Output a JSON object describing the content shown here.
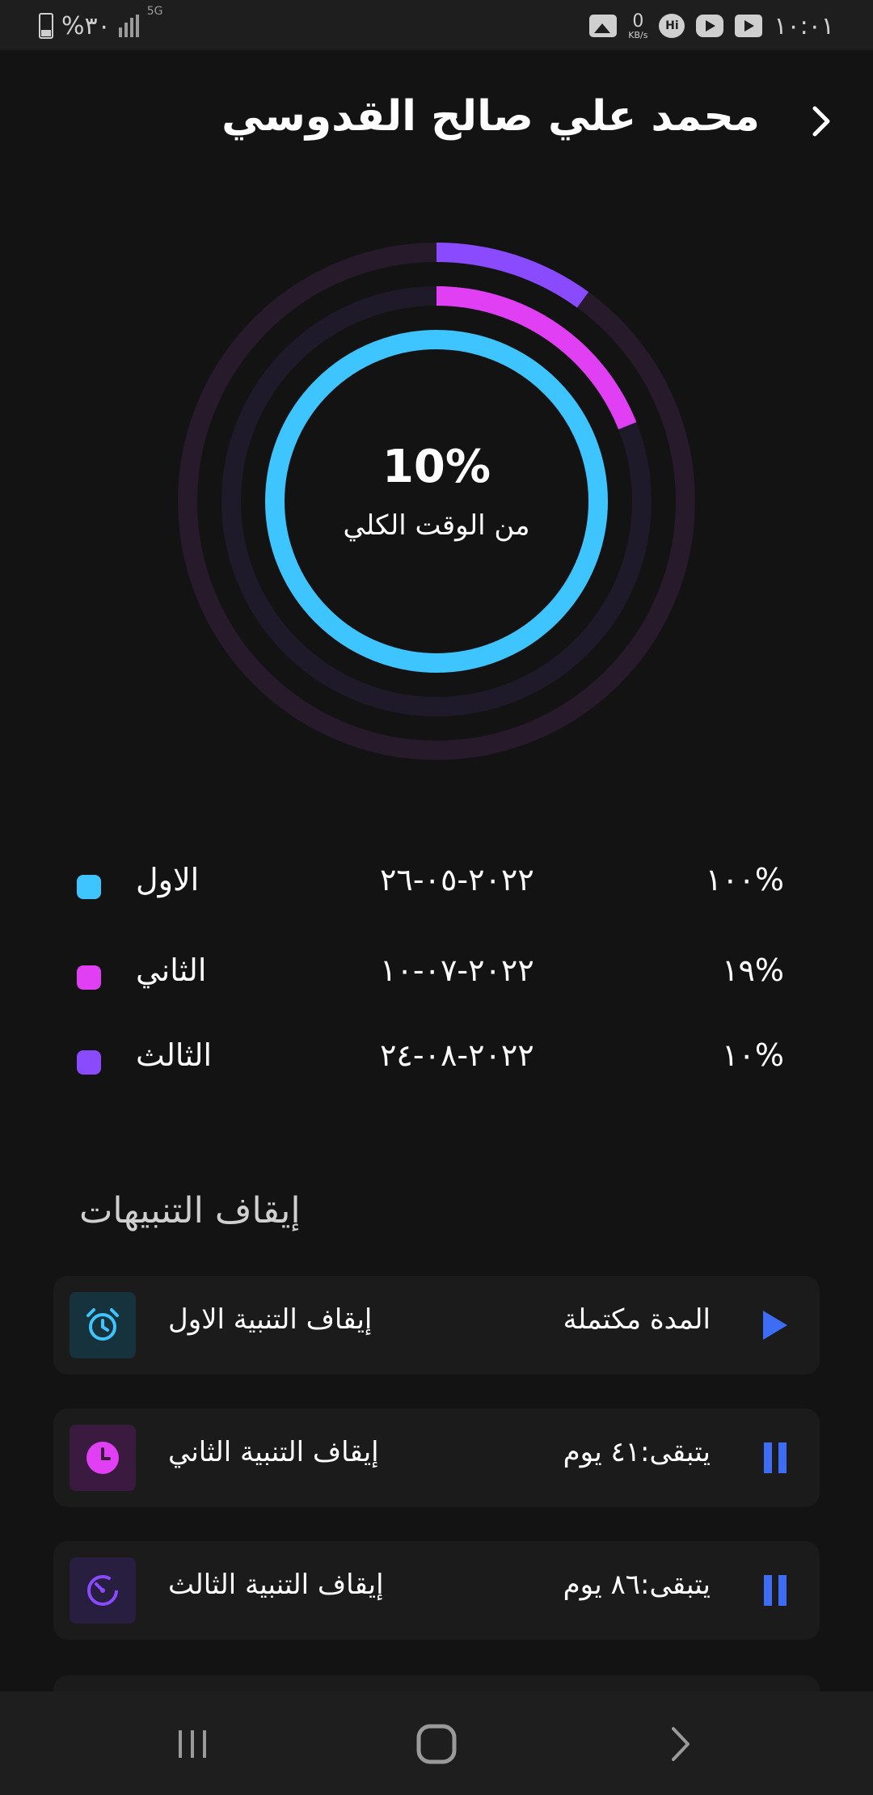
{
  "status_bar": {
    "battery": "%٣٠",
    "network": "5G",
    "speed_value": "0",
    "speed_unit": "KB/s",
    "time": "١٠:٠١"
  },
  "header": {
    "title": "محمد علي صالح القدوسي"
  },
  "progress": {
    "center_value": "10%",
    "center_label": "من الوقت الكلي",
    "rings": [
      {
        "name": "الاول",
        "fraction": 1.0,
        "color": "#3ec5ff"
      },
      {
        "name": "الثاني",
        "fraction": 0.19,
        "color": "#e13ff4"
      },
      {
        "name": "الثالث",
        "fraction": 0.1,
        "color": "#8a4bff"
      }
    ],
    "track_colors": [
      "#1e1a2a",
      "#261a2b"
    ]
  },
  "legend": [
    {
      "name": "الاول",
      "date": "٢٠٢٢-٠٥-٢٦",
      "percent": "١٠٠%",
      "color": "#3ec5ff"
    },
    {
      "name": "الثاني",
      "date": "٢٠٢٢-٠٧-١٠",
      "percent": "١٩%",
      "color": "#e13ff4"
    },
    {
      "name": "الثالث",
      "date": "٢٠٢٢-٠٨-٢٤",
      "percent": "١٠%",
      "color": "#8a4bff"
    }
  ],
  "alerts": {
    "section_title": "إيقاف التنبيهات",
    "items": [
      {
        "label": "إيقاف التنبية الاول",
        "status": "المدة مكتملة",
        "action": "play",
        "icon": "alarm-clock-icon",
        "icon_color": "#3ec5ff",
        "icon_bg": "#16323d"
      },
      {
        "label": "إيقاف التنبية الثاني",
        "status": "يتبقى:٤١ يوم",
        "action": "pause",
        "icon": "clock-icon",
        "icon_color": "#e13ff4",
        "icon_bg": "#3a1a3e"
      },
      {
        "label": "إيقاف التنبية الثالث",
        "status": "يتبقى:٨٦ يوم",
        "action": "pause",
        "icon": "timer-icon",
        "icon_color": "#8a4bff",
        "icon_bg": "#271e40"
      }
    ]
  },
  "accent_color": "#3d6df5"
}
